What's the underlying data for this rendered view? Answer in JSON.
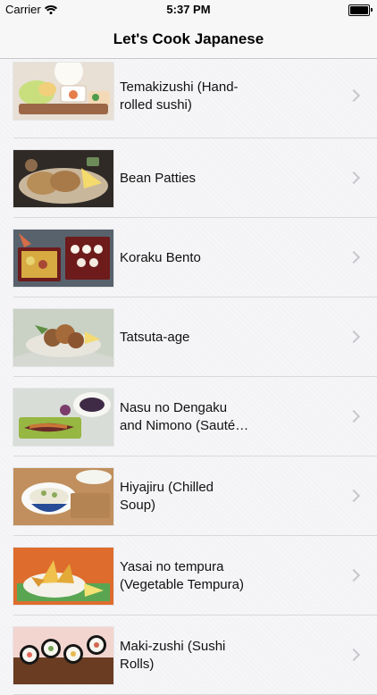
{
  "status": {
    "carrier": "Carrier",
    "time": "5:37 PM",
    "battery_percent": 100
  },
  "nav": {
    "title": "Let's Cook Japanese"
  },
  "recipes": [
    {
      "title": "Temakizushi (Hand-\nrolled sushi)",
      "thumb_icon": "temakizushi-thumb-icon"
    },
    {
      "title": "Bean Patties",
      "thumb_icon": "bean-patties-thumb-icon"
    },
    {
      "title": "Koraku Bento",
      "thumb_icon": "bento-thumb-icon"
    },
    {
      "title": "Tatsuta-age",
      "thumb_icon": "tatsuta-age-thumb-icon"
    },
    {
      "title": "Nasu no Dengaku\nand Nimono (Sauté…",
      "thumb_icon": "nasu-dengaku-thumb-icon"
    },
    {
      "title": "Hiyajiru (Chilled\nSoup)",
      "thumb_icon": "hiyajiru-thumb-icon"
    },
    {
      "title": "Yasai no tempura\n(Vegetable Tempura)",
      "thumb_icon": "tempura-thumb-icon"
    },
    {
      "title": "Maki-zushi (Sushi\nRolls)",
      "thumb_icon": "makizushi-thumb-icon"
    }
  ],
  "colors": {
    "chevron": "#c7c7cc",
    "separator": "#d9d9dd",
    "nav_background": "#f7f7f7"
  }
}
